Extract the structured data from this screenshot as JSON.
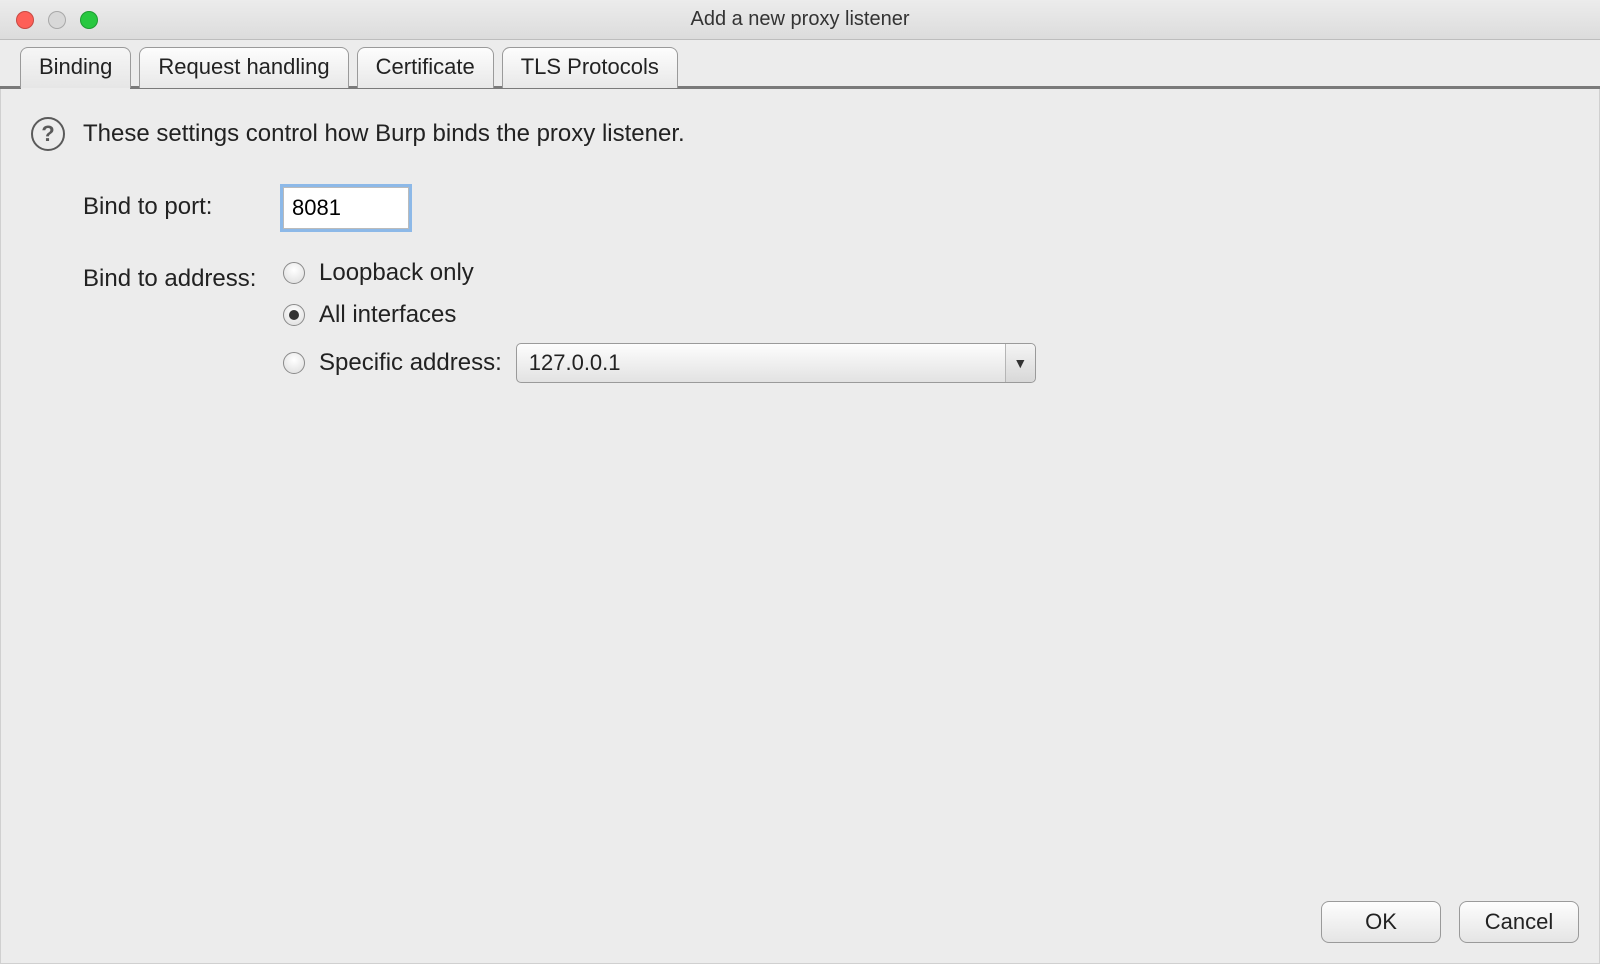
{
  "window": {
    "title": "Add a new proxy listener"
  },
  "tabs": [
    {
      "label": "Binding",
      "active": true
    },
    {
      "label": "Request handling",
      "active": false
    },
    {
      "label": "Certificate",
      "active": false
    },
    {
      "label": "TLS Protocols",
      "active": false
    }
  ],
  "help_text": "These settings control how Burp binds the proxy listener.",
  "form": {
    "bind_port_label": "Bind to port:",
    "bind_port_value": "8081",
    "bind_address_label": "Bind to address:",
    "radios": {
      "loopback": "Loopback only",
      "all": "All interfaces",
      "specific": "Specific address:"
    },
    "selected_radio": "all",
    "specific_address_value": "127.0.0.1"
  },
  "buttons": {
    "ok": "OK",
    "cancel": "Cancel"
  }
}
